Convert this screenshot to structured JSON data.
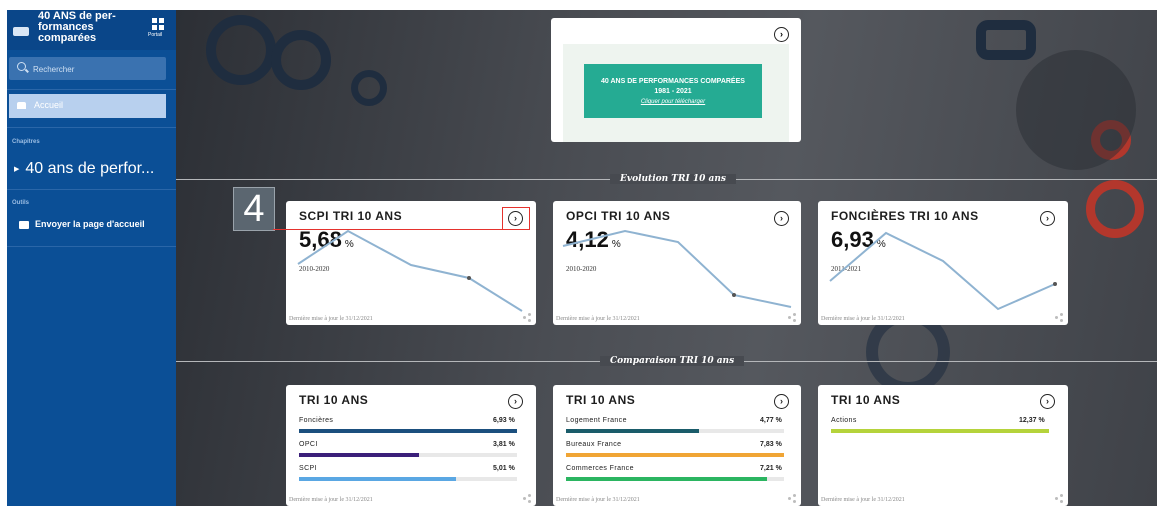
{
  "sidebar": {
    "title": "40 ANS de per-\nformances\ncomparées",
    "portal_label": "Portail",
    "search_placeholder": "Rechercher",
    "home_label": "Accueil",
    "chapters_header": "Chapitres",
    "chapter_item": "40 ans de perfor...",
    "tools_header": "Outils",
    "tool_item": "Envoyer la page d'accueil"
  },
  "banner": {
    "line1": "40 ANS DE PERFORMANCES COMPARÉES",
    "line2": "1981 - 2021",
    "link": "Cliquer pour télécharger"
  },
  "sections": {
    "evolution": "Evolution TRI 10 ans",
    "comparison": "Comparaison TRI 10 ans"
  },
  "step_badge": "4",
  "evolution_cards": [
    {
      "title": "SCPI TRI 10 ANS",
      "value": "5,68",
      "unit": "%",
      "period": "2010-2020",
      "footer": "Dernière mise à jour le 31/12/2021"
    },
    {
      "title": "OPCI TRI 10 ANS",
      "value": "4,12",
      "unit": "%",
      "period": "2010-2020",
      "footer": "Dernière mise à jour le 31/12/2021"
    },
    {
      "title": "FONCIÈRES TRI 10 ANS",
      "value": "6,93",
      "unit": "%",
      "period": "2011-2021",
      "footer": "Dernière mise à jour le 31/12/2021"
    }
  ],
  "comparison_cards": [
    {
      "title": "TRI 10 ANS",
      "footer": "Dernière mise à jour le 31/12/2021",
      "rows": [
        {
          "label": "Foncières",
          "value": "6,93 %",
          "pct": 1.0,
          "color": "#1b4f7e"
        },
        {
          "label": "OPCI",
          "value": "3,81 %",
          "pct": 0.55,
          "color": "#3b1f7a"
        },
        {
          "label": "SCPI",
          "value": "5,01 %",
          "pct": 0.72,
          "color": "#5aa7e3"
        }
      ]
    },
    {
      "title": "TRI 10 ANS",
      "footer": "Dernière mise à jour le 31/12/2021",
      "rows": [
        {
          "label": "Logement France",
          "value": "4,77 %",
          "pct": 0.61,
          "color": "#1a5c6a"
        },
        {
          "label": "Bureaux France",
          "value": "7,83 %",
          "pct": 1.0,
          "color": "#f0a535"
        },
        {
          "label": "Commerces France",
          "value": "7,21 %",
          "pct": 0.92,
          "color": "#2bb561"
        }
      ]
    },
    {
      "title": "TRI 10 ANS",
      "footer": "Dernière mise à jour le 31/12/2021",
      "rows": [
        {
          "label": "Actions",
          "value": "12,37 %",
          "pct": 1.0,
          "color": "#b5d33b"
        }
      ]
    }
  ],
  "colors": {
    "sidebar": "#0b4f96",
    "sparkline": "#8fb3d1",
    "highlight": "#e5322d"
  }
}
